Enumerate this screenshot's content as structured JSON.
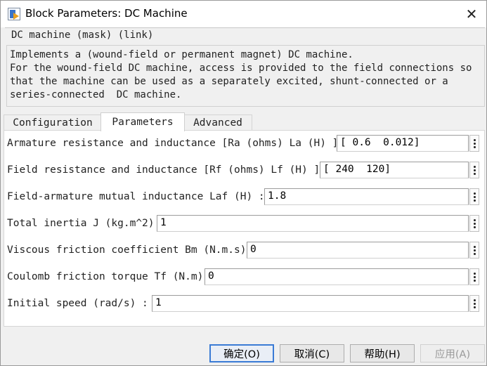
{
  "window": {
    "title": "Block Parameters: DC Machine",
    "close_glyph": "✕"
  },
  "mask": {
    "legend": "DC machine (mask) (link)",
    "description_lines": [
      "Implements a (wound-field or permanent magnet) DC machine.",
      "For the wound-field DC machine, access is provided to the field connections so",
      "that the machine can be used as a separately excited, shunt-connected or a",
      "series-connected  DC machine."
    ]
  },
  "tabs": [
    {
      "label": "Configuration",
      "active": false
    },
    {
      "label": "Parameters",
      "active": true
    },
    {
      "label": "Advanced",
      "active": false
    }
  ],
  "parameters": [
    {
      "label": "Armature resistance and inductance [Ra (ohms) La (H) ]",
      "value": "[ 0.6  0.012]"
    },
    {
      "label": "Field resistance and inductance [Rf (ohms) Lf (H) ]",
      "value": "[ 240  120]"
    },
    {
      "label": "Field-armature mutual inductance Laf (H) :",
      "value": "1.8"
    },
    {
      "label": "Total inertia J (kg.m^2)",
      "value": "1"
    },
    {
      "label": "Viscous friction coefficient Bm (N.m.s)",
      "value": "0"
    },
    {
      "label": "Coulomb friction torque Tf (N.m)",
      "value": "0"
    },
    {
      "label": "Initial speed (rad/s) :",
      "value": "1"
    }
  ],
  "buttons": {
    "ok": "确定(O)",
    "cancel": "取消(C)",
    "help": "帮助(H)",
    "apply": "应用(A)"
  },
  "icons": {
    "window": "simulink-block-icon",
    "close": "close-icon",
    "param_menu": "vertical-ellipsis-icon"
  },
  "colors": {
    "default_button_border": "#3a7bd5",
    "window_bg": "#f0f0f0"
  }
}
